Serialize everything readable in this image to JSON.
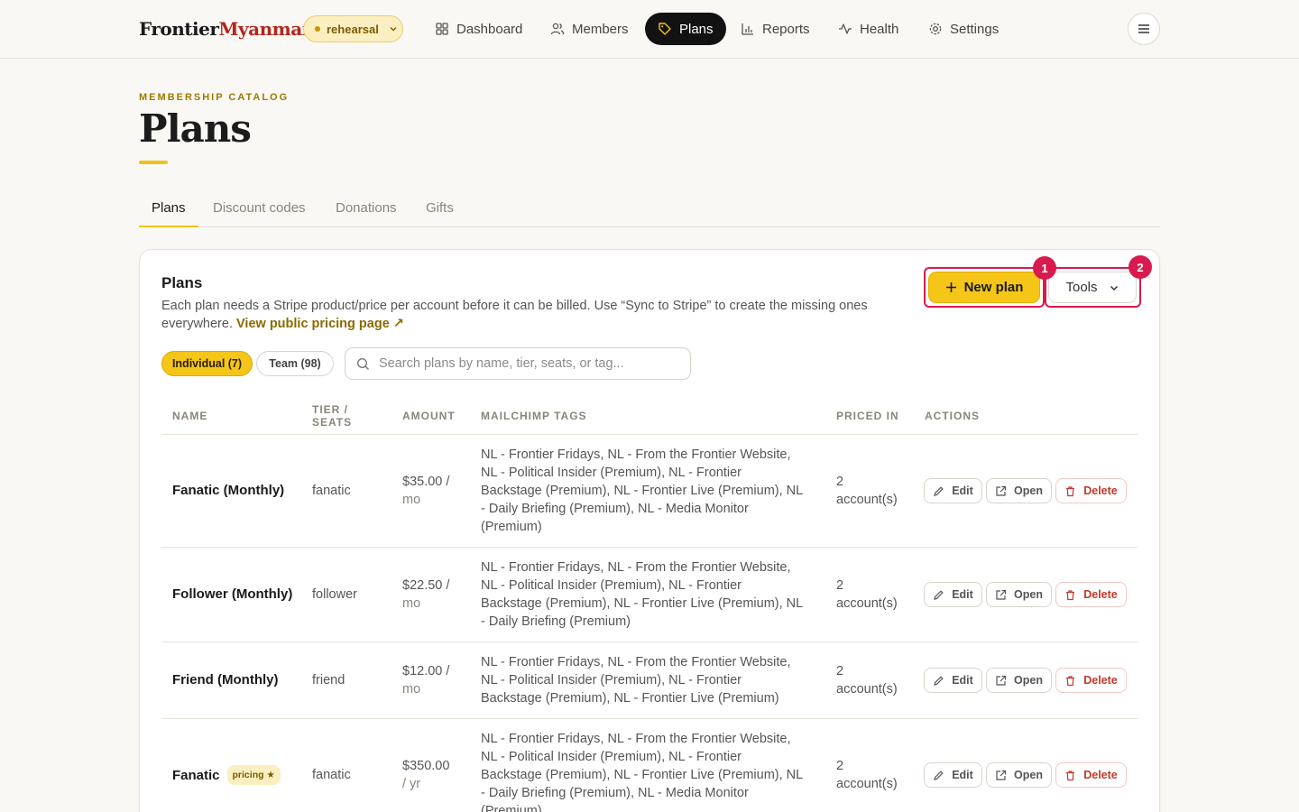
{
  "brand": {
    "part1": "Frontier",
    "part2": "Myanmar"
  },
  "environment": {
    "label": "rehearsal"
  },
  "nav": [
    {
      "label": "Dashboard",
      "icon": "dashboard-icon",
      "active": false
    },
    {
      "label": "Members",
      "icon": "users-icon",
      "active": false
    },
    {
      "label": "Plans",
      "icon": "tag-icon",
      "active": true
    },
    {
      "label": "Reports",
      "icon": "bar-chart-icon",
      "active": false
    },
    {
      "label": "Health",
      "icon": "activity-icon",
      "active": false
    },
    {
      "label": "Settings",
      "icon": "gear-icon",
      "active": false
    }
  ],
  "header": {
    "eyebrow": "MEMBERSHIP CATALOG",
    "title": "Plans"
  },
  "tabs": [
    {
      "label": "Plans",
      "active": true
    },
    {
      "label": "Discount codes",
      "active": false
    },
    {
      "label": "Donations",
      "active": false
    },
    {
      "label": "Gifts",
      "active": false
    }
  ],
  "card": {
    "title": "Plans",
    "description": "Each plan needs a Stripe product/price per account before it can be billed. Use “Sync to Stripe” to create the missing ones everywhere.",
    "link_label": "View public pricing page ↗",
    "new_button": "New plan",
    "tools_button": "Tools",
    "highlight_badges": [
      "1",
      "2"
    ]
  },
  "filters": {
    "individual": "Individual (7)",
    "team": "Team (98)"
  },
  "search": {
    "placeholder": "Search plans by name, tier, seats, or tag...",
    "value": ""
  },
  "table": {
    "headers": {
      "name": "NAME",
      "tier_line1": "TIER /",
      "tier_line2": "SEATS",
      "amount": "AMOUNT",
      "tags": "MAILCHIMP TAGS",
      "priced": "PRICED IN",
      "actions": "ACTIONS"
    },
    "action_labels": {
      "edit": "Edit",
      "open": "Open",
      "delete": "Delete"
    },
    "rows": [
      {
        "name": "Fanatic (Monthly)",
        "badge": "",
        "tier": "fanatic",
        "amount_line1": "$35.00 /",
        "amount_line2": "mo",
        "tags": [
          "NL - Frontier Fridays, NL - From the Frontier Website,",
          "NL - Political Insider (Premium), NL - Frontier",
          "Backstage (Premium), NL - Frontier Live (Premium), NL",
          "- Daily Briefing (Premium), NL - Media Monitor",
          "(Premium)"
        ],
        "priced_line1": "2",
        "priced_line2": "account(s)"
      },
      {
        "name": "Follower (Monthly)",
        "badge": "",
        "tier": "follower",
        "amount_line1": "$22.50 /",
        "amount_line2": "mo",
        "tags": [
          "NL - Frontier Fridays, NL - From the Frontier Website,",
          "NL - Political Insider (Premium), NL - Frontier",
          "Backstage (Premium), NL - Frontier Live (Premium), NL",
          "- Daily Briefing (Premium)"
        ],
        "priced_line1": "2",
        "priced_line2": "account(s)"
      },
      {
        "name": "Friend (Monthly)",
        "badge": "",
        "tier": "friend",
        "amount_line1": "$12.00 /",
        "amount_line2": "mo",
        "tags": [
          "NL - Frontier Fridays, NL - From the Frontier Website,",
          "NL - Political Insider (Premium), NL - Frontier",
          "Backstage (Premium), NL - Frontier Live (Premium)"
        ],
        "priced_line1": "2",
        "priced_line2": "account(s)"
      },
      {
        "name": "Fanatic",
        "badge": "pricing ★",
        "tier": "fanatic",
        "amount_line1": "$350.00",
        "amount_line2": "/ yr",
        "tags": [
          "NL - Frontier Fridays, NL - From the Frontier Website,",
          "NL - Political Insider (Premium), NL - Frontier",
          "Backstage (Premium), NL - Frontier Live (Premium), NL",
          "- Daily Briefing (Premium), NL - Media Monitor",
          "(Premium)"
        ],
        "priced_line1": "2",
        "priced_line2": "account(s)"
      }
    ]
  },
  "colors": {
    "accent": "#f5c518",
    "highlight": "#d81b4f",
    "brand_red": "#b3261e",
    "danger": "#c0392b"
  }
}
